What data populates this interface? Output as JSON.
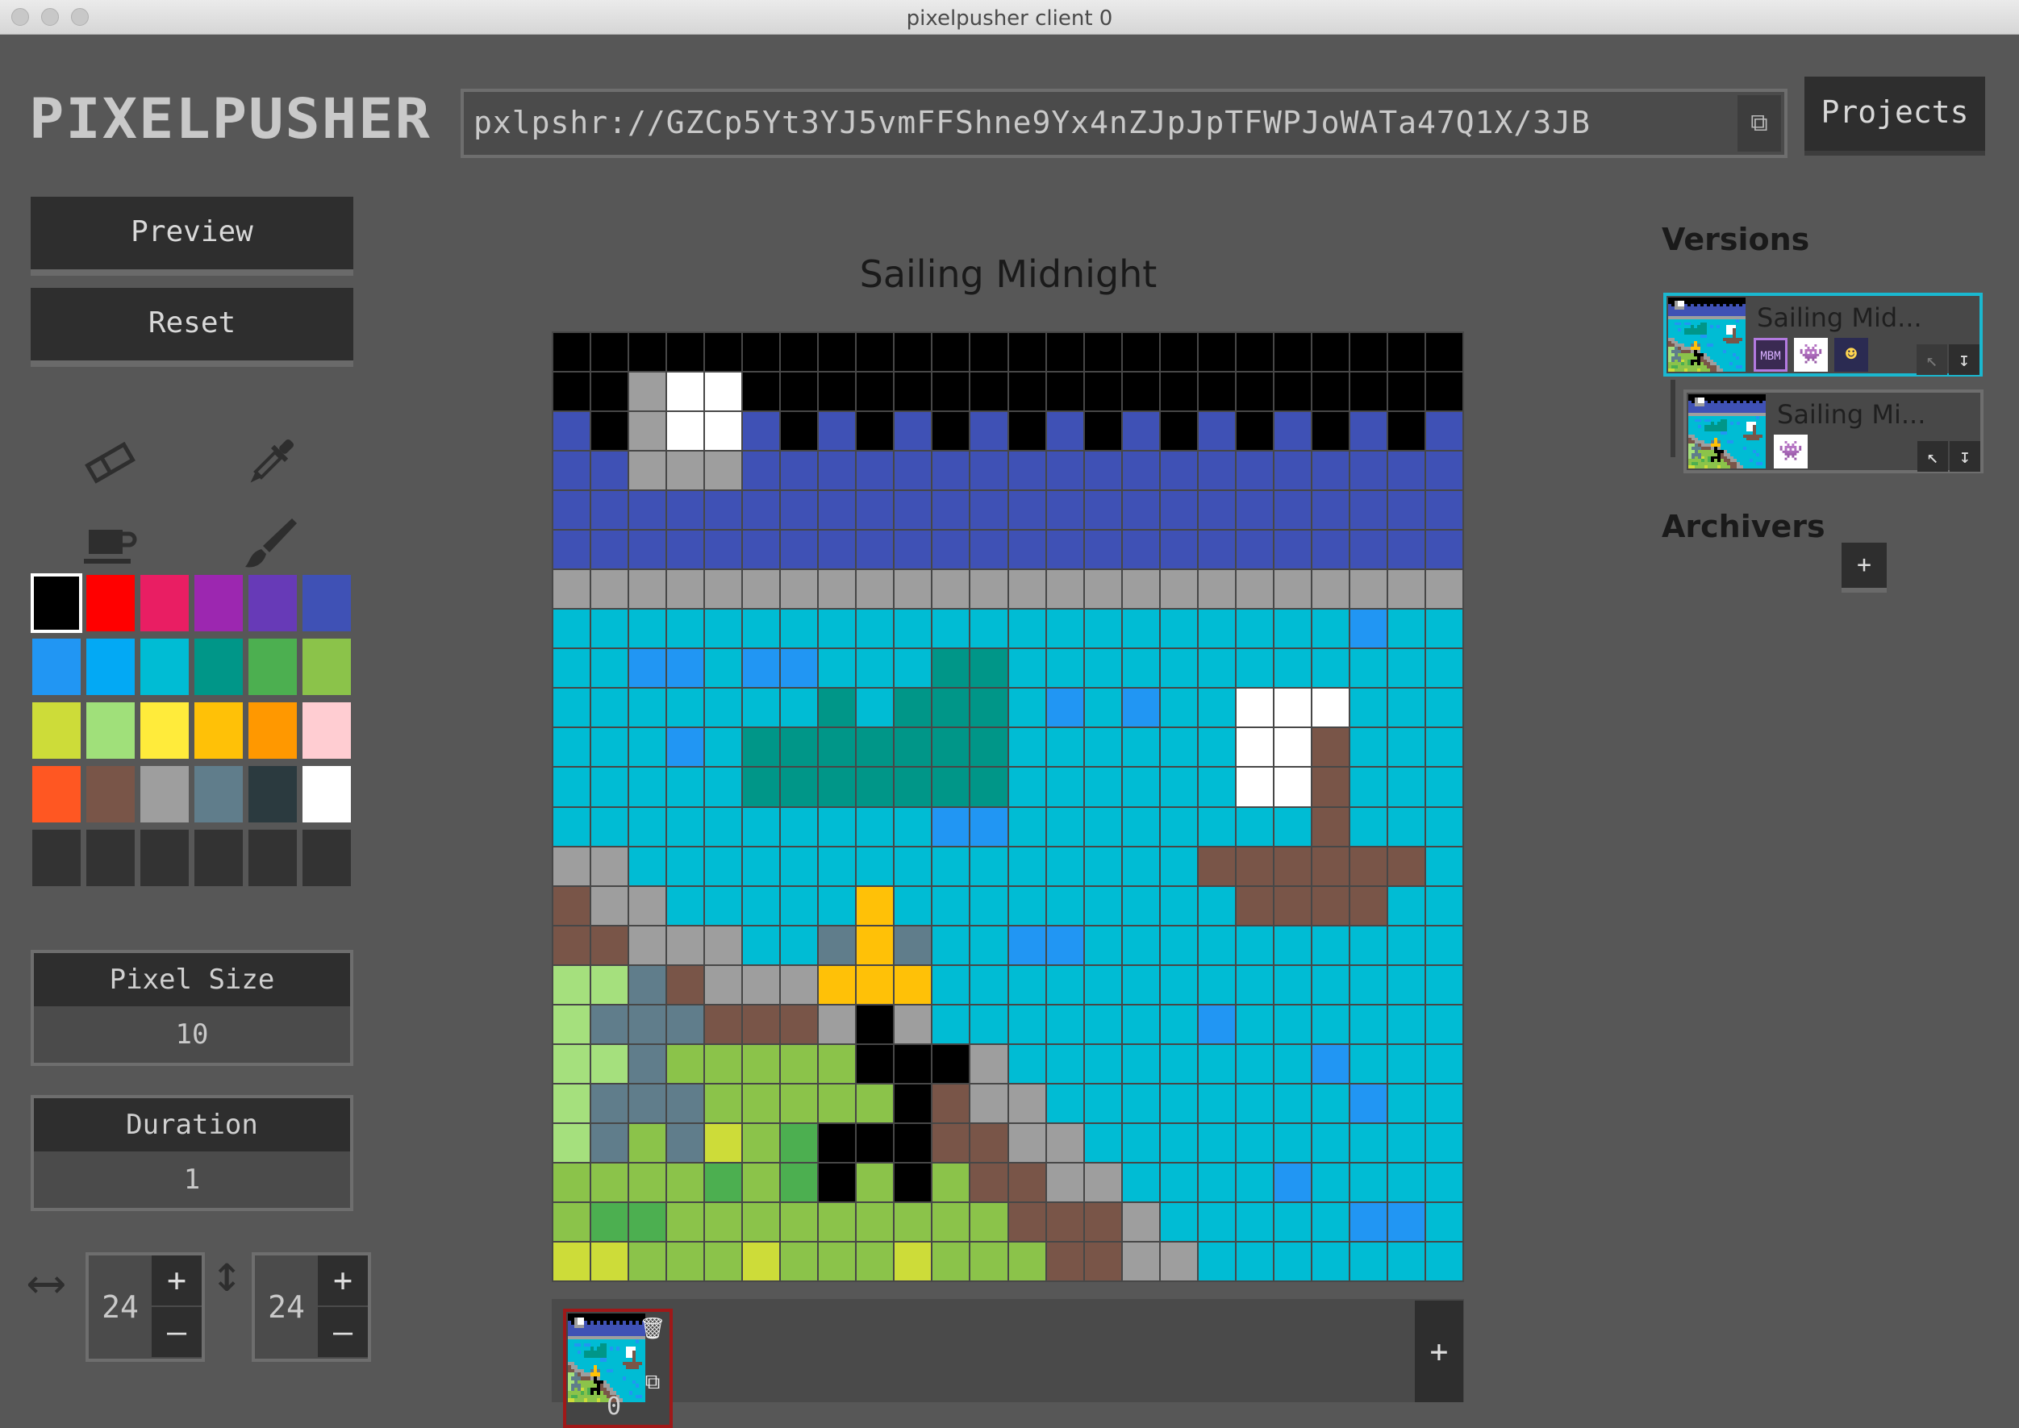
{
  "window": {
    "title": "pixelpusher client 0"
  },
  "header": {
    "logo": "PIXELPUSHER",
    "url": "pxlpshr://GZCp5Yt3YJ5vmFFShne9Yx4nZJpJpTFWPJoWATa47Q1X/3JB",
    "projects_label": "Projects"
  },
  "toolbar": {
    "preview_label": "Preview",
    "reset_label": "Reset",
    "tools": [
      "eraser-icon",
      "eyedropper-icon",
      "coffee-cup-icon",
      "brush-icon"
    ]
  },
  "palette": {
    "selected_index": 0,
    "colors": [
      "#000000",
      "#ff0000",
      "#e91e63",
      "#9c27b0",
      "#673ab7",
      "#3f51b5",
      "#2196f3",
      "#03a9f4",
      "#00bcd4",
      "#009688",
      "#4caf50",
      "#8bc34a",
      "#cddc39",
      "#a0e07a",
      "#ffeb3b",
      "#ffc107",
      "#ff9800",
      "#ffcdd2",
      "#ff5722",
      "#795548",
      "#9e9e9e",
      "#607d8b",
      "#2b3a3f",
      "#ffffff",
      "#333333",
      "#333333",
      "#333333",
      "#333333",
      "#333333",
      "#333333"
    ]
  },
  "settings": {
    "pixel_size_label": "Pixel Size",
    "pixel_size_value": "10",
    "duration_label": "Duration",
    "duration_value": "1",
    "width_value": "24",
    "height_value": "24",
    "plus": "+",
    "minus": "–"
  },
  "canvas": {
    "title": "Sailing Midnight",
    "legend": {
      "K": "#000000",
      "W": "#ffffff",
      "G": "#9e9e9e",
      "I": "#3f51b5",
      "C": "#00bcd4",
      "B": "#2196f3",
      "T": "#009688",
      "R": "#795548",
      "Y": "#ffc107",
      "S": "#607d8b",
      "L": "#a5e07d",
      "g": "#8bc34a",
      "D": "#4caf50",
      "l": "#cddc39"
    },
    "rows": [
      "KKKKKKKKKKKKKKKKKKKKKKKK",
      "KKGWWKKKKKKKKKKKKKKKKKKK",
      "IKGWWIKIKIKIKIKIKIKIKIKI",
      "IIGGGIIIIIIIIIIIIIIIIIII",
      "IIIIIIIIIIIIIIIIIIIIIIII",
      "IIIIIIIIIIIIIIIIIIIIIIII",
      "GGGGGGGGGGGGGGGGGGGGGGGG",
      "CCCCCCCCCCCCCCCCCCCCCBCC",
      "CCBBCBBCCCTTCCCCCCCCCCCC",
      "CCCCCCCTCTTTCBCBCCWWWCCC",
      "CCCBCTTTTTTTCCCCCCWWRCCC",
      "CCCCCTTTTTTTCCCCCCWWRCCC",
      "CCCCCCCCCCBBCCCCCCCCRCCC",
      "GGCCCCCCCCCCCCCCCRRRRRRC",
      "RGGCCCCCYCCCCCCCCCRRRRCC",
      "RRGGGCCSYSCCBBCCCCCCCCCC",
      "LLSRGGGYYYCCCCCCCCCCCCCC",
      "LSSSRRRGKGCCCCCCCBCCCCCC",
      "LLSgggggKKKGCCCCCCCCBCCC",
      "LSSSgggggKRGGCCCCCCCCBCC",
      "LSgSlgDKKKRRGGCCCCCCCCCC",
      "ggggDgDKgKgRRGGCCCCBCCCC",
      "gDDgggggggggRRRGCCCCCBBC",
      "llggglggglgggRRGGCCCCCCC"
    ]
  },
  "frames": {
    "items": [
      {
        "index": "0"
      }
    ],
    "add_label": "+"
  },
  "versions": {
    "heading": "Versions",
    "items": [
      {
        "title": "Sailing Mid...",
        "tags": [
          "MBM",
          "ghost",
          "face"
        ]
      },
      {
        "title": "Sailing Mi...",
        "tags": [
          "ghost"
        ]
      }
    ]
  },
  "archivers": {
    "heading": "Archivers",
    "add_label": "+"
  }
}
